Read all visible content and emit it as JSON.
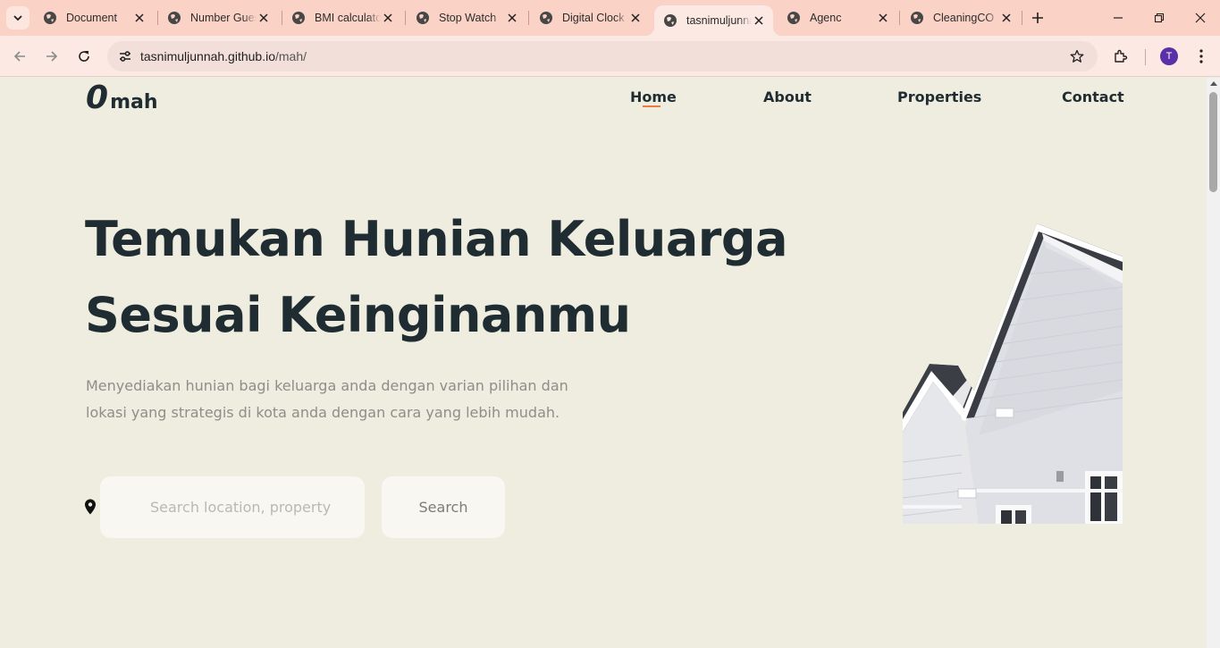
{
  "browser": {
    "tabs": [
      {
        "title": "Document"
      },
      {
        "title": "Number Guessing Game"
      },
      {
        "title": "BMI calculator"
      },
      {
        "title": "Stop Watch"
      },
      {
        "title": "Digital Clock"
      },
      {
        "title": "tasnimuljunnah",
        "active": true
      },
      {
        "title": "Agenc"
      },
      {
        "title": "CleaningCO"
      }
    ],
    "url": {
      "host": "tasnimuljunnah.github.io",
      "path": "/mah/"
    },
    "profile_initial": "T",
    "icons": [
      "tab-search-icon",
      "globe-icon",
      "close-icon",
      "plus-icon",
      "minimize-icon",
      "restore-icon",
      "back-icon",
      "forward-icon",
      "reload-icon",
      "site-settings-icon",
      "star-icon",
      "extensions-icon",
      "kebab-menu-icon"
    ]
  },
  "site": {
    "logo": {
      "mark": "0",
      "text": "mah"
    },
    "nav": {
      "home": "Home",
      "about": "About",
      "properties": "Properties",
      "contact": "Contact",
      "active": "Home"
    },
    "hero": {
      "title_line1": "Temukan Hunian Keluarga",
      "title_line2": "Sesuai Keinginanmu",
      "desc_line1": "Menyediakan hunian bagi keluarga anda dengan varian pilihan dan",
      "desc_line2": "lokasi yang strategis di kota anda dengan cara yang lebih mudah."
    },
    "search": {
      "placeholder": "Search location, property",
      "value": "",
      "button_label": "Search",
      "icon": "location-pin-icon"
    },
    "image": "house-photo"
  },
  "colors": {
    "page_bg": "#efeddf",
    "heading": "#1f2d33",
    "body_text": "#8e8e8a",
    "accent": "#ee7b3e",
    "input_bg": "#f8f7f2",
    "tabbar_bg": "#fbd3c6",
    "toolbar_bg": "#fce9e3"
  }
}
